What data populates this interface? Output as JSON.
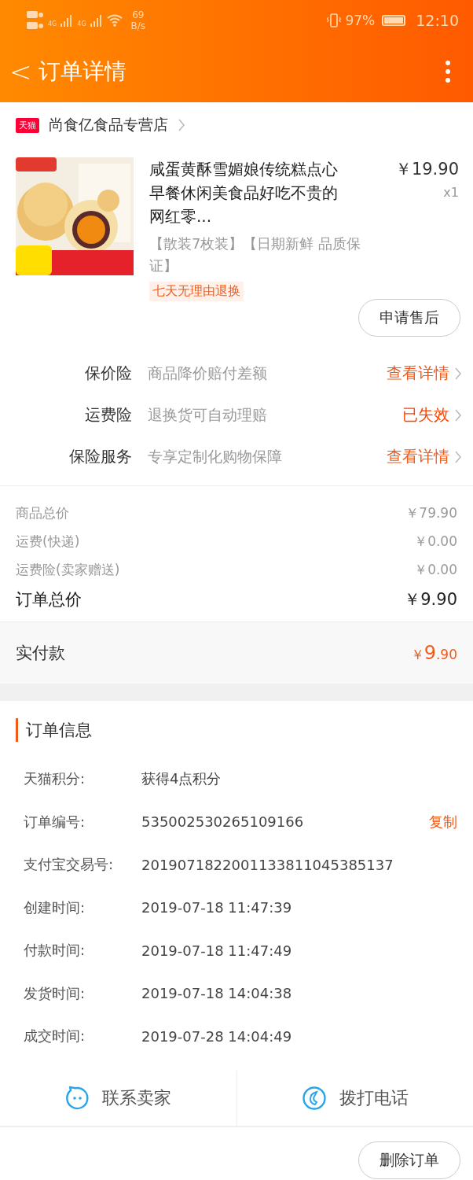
{
  "status_bar": {
    "network": [
      "4G",
      "4G"
    ],
    "speed": "69",
    "speed_unit": "B/s",
    "battery": "97%",
    "time": "12:10"
  },
  "header": {
    "back": "<",
    "title": "订单详情"
  },
  "shop": {
    "badge": "天猫",
    "name": "尚食亿食品专营店"
  },
  "product": {
    "kind": "picture",
    "title": "咸蛋黄酥雪媚娘传统糕点心早餐休闲美食品好吃不贵的网红零...",
    "price": "￥19.90",
    "quantity": "x1",
    "sku": "【散装7枚装】【日期新鲜 品质保证】",
    "tag": "七天无理由退换"
  },
  "after_sale_button": "申请售后",
  "insurance": [
    {
      "label": "保价险",
      "desc": "商品降价赔付差额",
      "action": "查看详情",
      "expired": false
    },
    {
      "label": "运费险",
      "desc": "退换货可自动理赔",
      "action": "已失效",
      "expired": true
    },
    {
      "label": "保险服务",
      "desc": "专享定制化购物保障",
      "action": "查看详情",
      "expired": false
    }
  ],
  "summary": [
    {
      "label": "商品总价",
      "value": "￥79.90",
      "kind": "minor"
    },
    {
      "label": "运费(快递)",
      "value": "￥0.00",
      "kind": "minor"
    },
    {
      "label": "运费险(卖家赠送)",
      "value": "￥0.00",
      "kind": "minor"
    },
    {
      "label": "订单总价",
      "value": "￥9.90",
      "kind": "total"
    }
  ],
  "paid": {
    "label": "实付款",
    "currency": "￥",
    "integer": "9",
    "decimal": ".90"
  },
  "order_info": {
    "title": "订单信息",
    "rows": [
      {
        "label": "天猫积分:",
        "value": "获得4点积分"
      },
      {
        "label": "订单编号:",
        "value": "535002530265109166",
        "action": "复制"
      },
      {
        "label": "支付宝交易号:",
        "value": "2019071822001133811045385137"
      },
      {
        "label": "创建时间:",
        "value": "2019-07-18 11:47:39"
      },
      {
        "label": "付款时间:",
        "value": "2019-07-18 11:47:49"
      },
      {
        "label": "发货时间:",
        "value": "2019-07-18 14:04:38"
      },
      {
        "label": "成交时间:",
        "value": "2019-07-28 14:04:49"
      }
    ]
  },
  "contact": [
    {
      "label": "联系卖家",
      "kind": "chat"
    },
    {
      "label": "拨打电话",
      "kind": "phone"
    }
  ],
  "delete_button": "删除订单"
}
